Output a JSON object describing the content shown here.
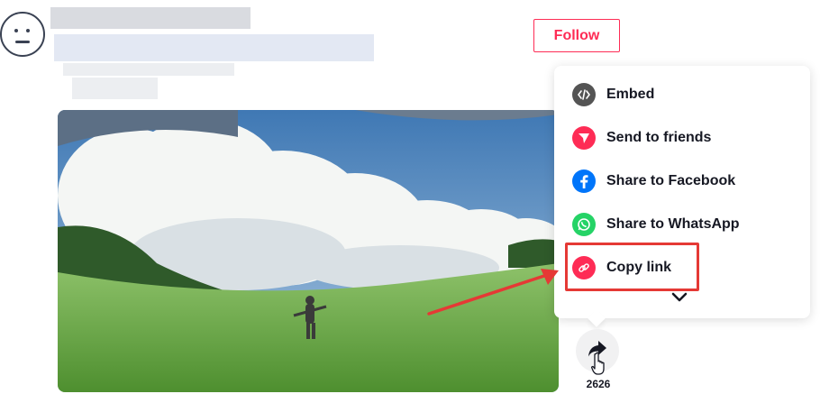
{
  "header": {
    "follow_label": "Follow"
  },
  "share_menu": {
    "items": [
      {
        "label": "Embed",
        "icon": "code-icon",
        "color": "#545454"
      },
      {
        "label": "Send to friends",
        "icon": "paper-plane-icon",
        "color": "#fe2c55"
      },
      {
        "label": "Share to Facebook",
        "icon": "facebook-icon",
        "color": "#0075fa"
      },
      {
        "label": "Share to WhatsApp",
        "icon": "whatsapp-icon",
        "color": "#25d366"
      },
      {
        "label": "Copy link",
        "icon": "link-icon",
        "color": "#fe2c55"
      }
    ],
    "more_icon": "chevron-down-icon"
  },
  "actions": {
    "share_count": "2626",
    "share_icon": "share-arrow-icon"
  },
  "colors": {
    "accent": "#fe2c55",
    "highlight": "#e53935"
  }
}
